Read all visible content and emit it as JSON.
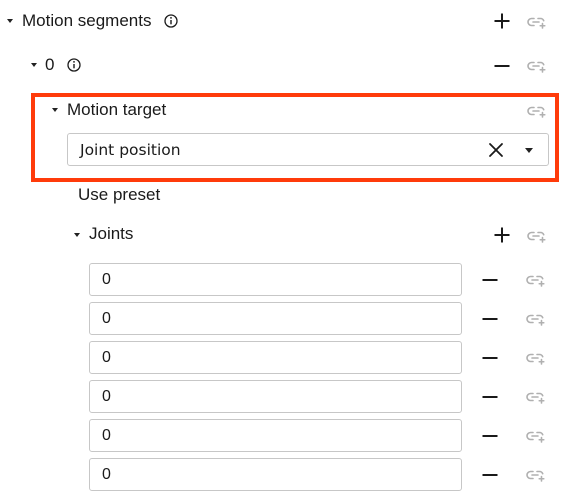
{
  "motion_segments": {
    "label": "Motion segments",
    "info_icon": "info-icon",
    "add_icon": "plus-icon",
    "link_icon": "link-icon"
  },
  "segment": {
    "label": "0",
    "info_icon": "info-icon",
    "remove_icon": "minus-icon",
    "link_icon": "link-icon"
  },
  "motion_target": {
    "label": "Motion target",
    "link_icon": "link-icon",
    "select_value": "Joint position",
    "clear_icon": "close-icon",
    "dropdown_icon": "chevron-down-icon",
    "highlight_color": "#ff3b0a"
  },
  "use_preset": {
    "label": "Use preset"
  },
  "joints": {
    "label": "Joints",
    "add_icon": "plus-icon",
    "link_icon": "link-icon",
    "values": [
      "0",
      "0",
      "0",
      "0",
      "0",
      "0"
    ]
  }
}
